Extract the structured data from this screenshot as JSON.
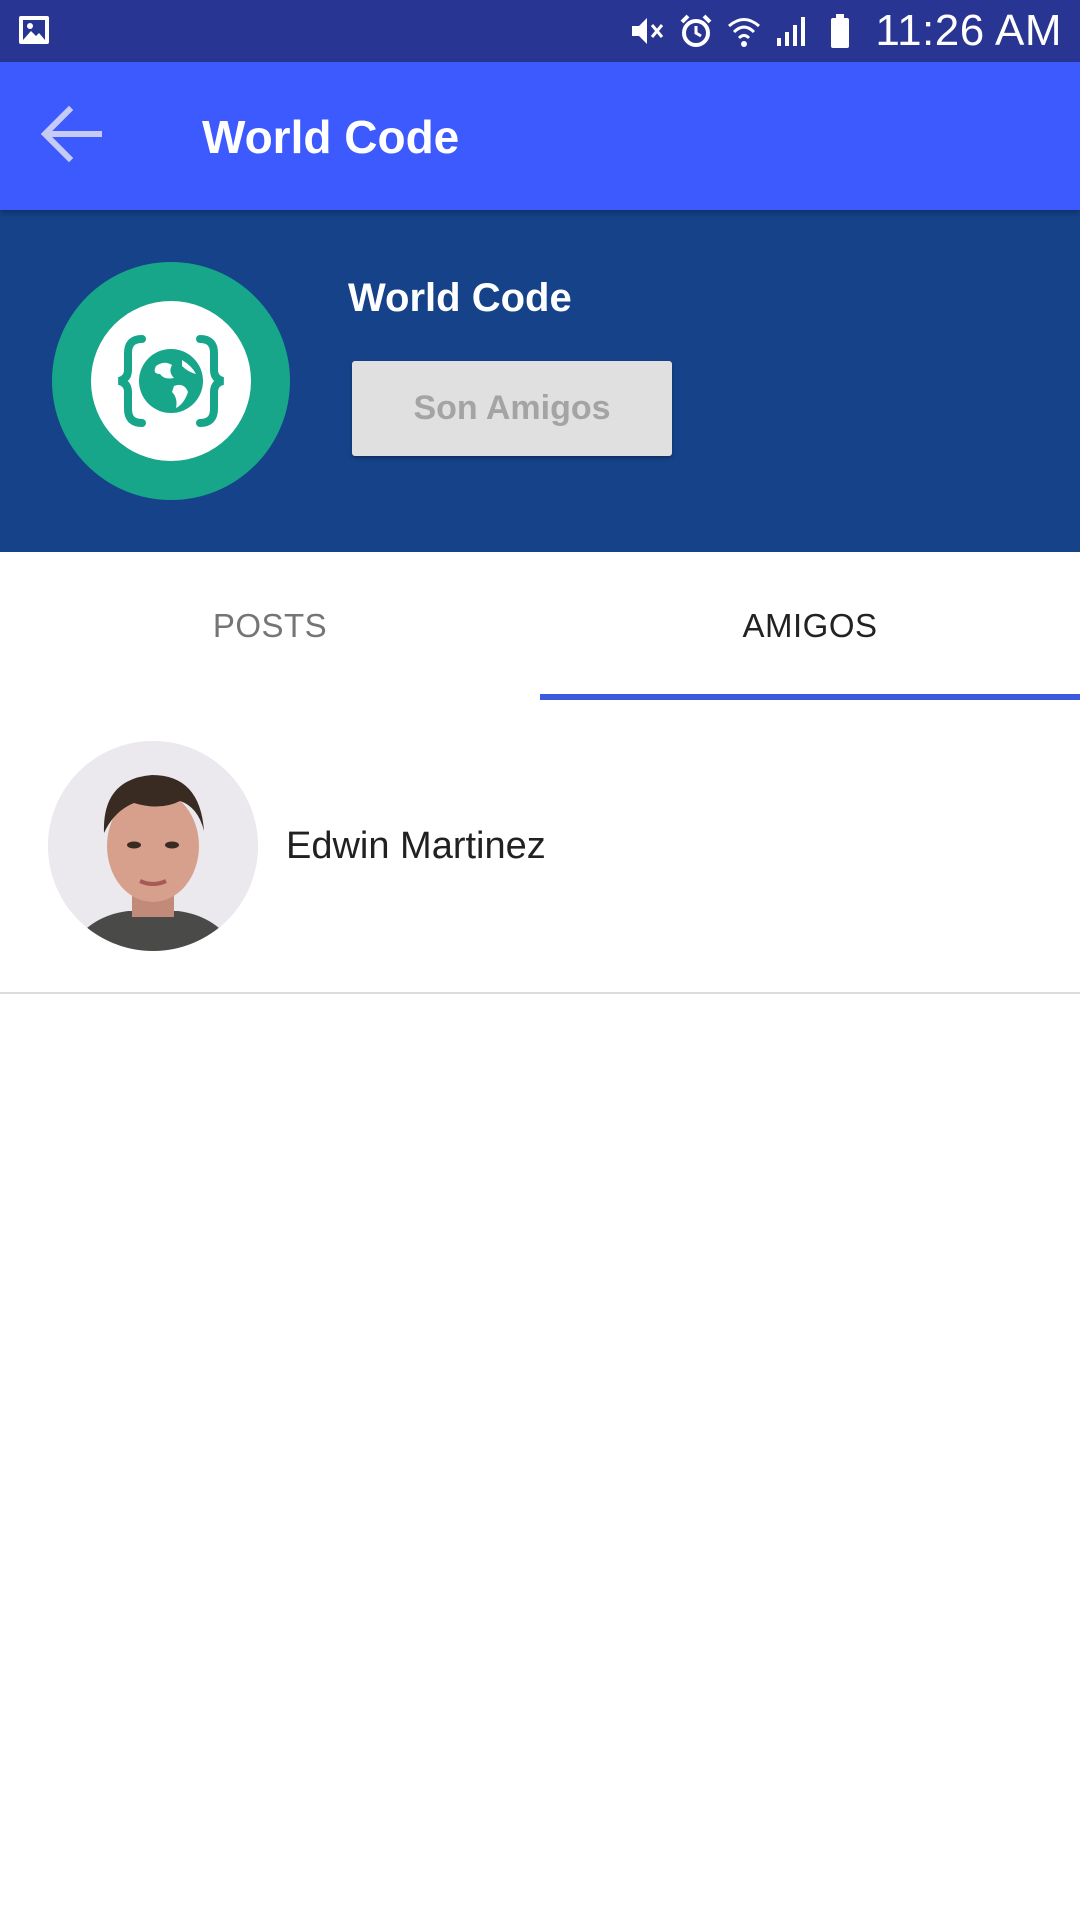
{
  "status_bar": {
    "time": "11:26 AM",
    "icons": [
      "image-notification-icon",
      "mute-icon",
      "alarm-icon",
      "wifi-icon",
      "signal-icon",
      "battery-icon"
    ]
  },
  "app_bar": {
    "title": "World Code",
    "back_icon": "arrow-back-icon"
  },
  "profile": {
    "name": "World Code",
    "friend_status_label": "Son Amigos",
    "avatar_icon": "world-code-logo"
  },
  "tabs": [
    {
      "label": "POSTS",
      "active": false
    },
    {
      "label": "AMIGOS",
      "active": true
    }
  ],
  "friends": [
    {
      "name": "Edwin Martinez"
    }
  ],
  "colors": {
    "status_bar": "#283593",
    "app_bar": "#3d5afe",
    "profile_header": "#154289",
    "logo_green": "#17a68a",
    "tab_indicator": "#3d5adf"
  }
}
